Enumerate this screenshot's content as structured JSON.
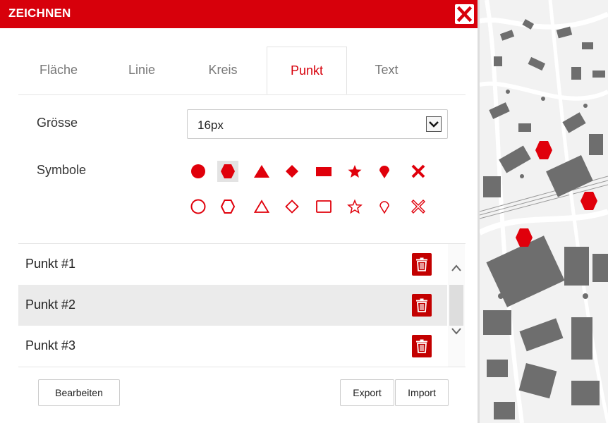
{
  "dialog": {
    "title": "ZEICHNEN",
    "close_icon": "close-icon"
  },
  "tabs": [
    {
      "label": "Fläche",
      "active": false
    },
    {
      "label": "Linie",
      "active": false
    },
    {
      "label": "Kreis",
      "active": false
    },
    {
      "label": "Punkt",
      "active": true
    },
    {
      "label": "Text",
      "active": false
    }
  ],
  "settings": {
    "size_label": "Grösse",
    "size_value": "16px",
    "symbols_label": "Symbole"
  },
  "symbols": {
    "filled": [
      "circle",
      "hexagon",
      "triangle",
      "diamond",
      "rectangle",
      "star",
      "marker",
      "cross"
    ],
    "outline": [
      "circle",
      "hexagon",
      "triangle",
      "diamond",
      "rectangle",
      "star",
      "marker",
      "cross"
    ],
    "selected": "hexagon-filled",
    "color": "#e0000b"
  },
  "points": [
    {
      "label": "Punkt #1"
    },
    {
      "label": "Punkt #2"
    },
    {
      "label": "Punkt #3"
    }
  ],
  "buttons": {
    "edit": "Bearbeiten",
    "export": "Export",
    "import": "Import"
  },
  "colors": {
    "accent": "#d7000b",
    "delete_button": "#c30000"
  }
}
